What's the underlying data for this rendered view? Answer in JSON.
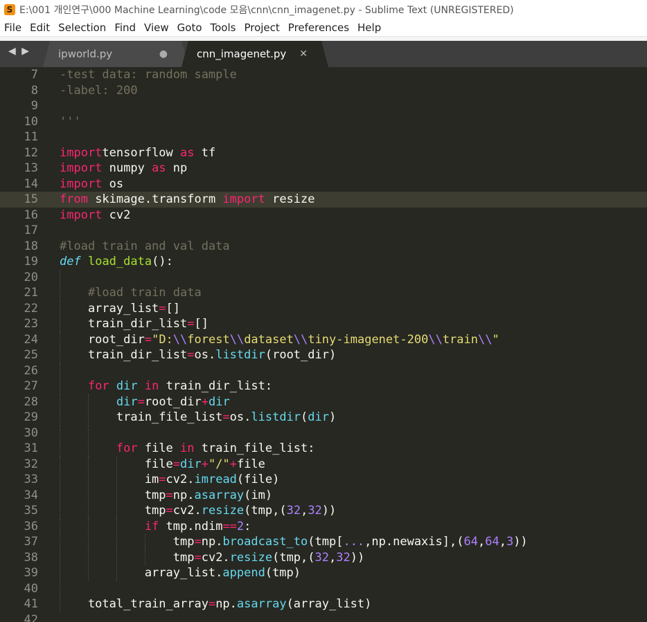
{
  "window": {
    "title": "E:\\001 개인연구\\000 Machine Learning\\code 모음\\cnn\\cnn_imagenet.py - Sublime Text (UNREGISTERED)",
    "app_icon_letter": "S"
  },
  "menu": [
    "File",
    "Edit",
    "Selection",
    "Find",
    "View",
    "Goto",
    "Tools",
    "Project",
    "Preferences",
    "Help"
  ],
  "tabs": [
    {
      "name": "ipworld.py",
      "marker": "●",
      "active": false
    },
    {
      "name": "cnn_imagenet.py",
      "marker": "✕",
      "active": true
    }
  ],
  "nav_arrows": "◀ ▶",
  "editor": {
    "current_line": 15,
    "colors": {
      "background": "#272822",
      "keyword": "#f92672",
      "string": "#e6db74",
      "comment": "#75715e",
      "number": "#ae81ff",
      "function": "#a6e22e",
      "builtin": "#66d9ef"
    },
    "lines": [
      {
        "n": 7,
        "segs": [
          [
            "cm",
            "-test data: random sample"
          ]
        ]
      },
      {
        "n": 8,
        "segs": [
          [
            "cm",
            "-label: 200"
          ]
        ]
      },
      {
        "n": 9,
        "segs": []
      },
      {
        "n": 10,
        "segs": [
          [
            "cm",
            "'''"
          ]
        ]
      },
      {
        "n": 11,
        "segs": []
      },
      {
        "n": 12,
        "segs": [
          [
            "kw",
            "import"
          ],
          [
            "",
            "tensorflow "
          ],
          [
            "kw",
            "as"
          ],
          [
            "",
            " tf"
          ]
        ]
      },
      {
        "n": 13,
        "segs": [
          [
            "kw",
            "import"
          ],
          [
            "",
            " numpy "
          ],
          [
            "kw",
            "as"
          ],
          [
            "",
            " np"
          ]
        ]
      },
      {
        "n": 14,
        "segs": [
          [
            "kw",
            "import"
          ],
          [
            "",
            " os"
          ]
        ]
      },
      {
        "n": 15,
        "segs": [
          [
            "kw",
            "from"
          ],
          [
            "",
            " skimage.transform "
          ],
          [
            "kw",
            "import"
          ],
          [
            "",
            " resize"
          ]
        ]
      },
      {
        "n": 16,
        "segs": [
          [
            "kw",
            "import"
          ],
          [
            "",
            " cv2"
          ]
        ]
      },
      {
        "n": 17,
        "segs": []
      },
      {
        "n": 18,
        "segs": [
          [
            "cm",
            "#load train and val data"
          ]
        ]
      },
      {
        "n": 19,
        "segs": [
          [
            "it",
            "def"
          ],
          [
            "",
            " "
          ],
          [
            "fn",
            "load_data"
          ],
          [
            "",
            "():"
          ]
        ]
      },
      {
        "n": 20,
        "segs": []
      },
      {
        "n": 21,
        "segs": [
          [
            "",
            "    "
          ],
          [
            "cm",
            "#load train data"
          ]
        ]
      },
      {
        "n": 22,
        "segs": [
          [
            "",
            "    array_list"
          ],
          [
            "kw",
            "="
          ],
          [
            "",
            "[]"
          ]
        ]
      },
      {
        "n": 23,
        "segs": [
          [
            "",
            "    train_dir_list"
          ],
          [
            "kw",
            "="
          ],
          [
            "",
            "[]"
          ]
        ]
      },
      {
        "n": 24,
        "segs": [
          [
            "",
            "    root_dir"
          ],
          [
            "kw",
            "="
          ],
          [
            "st",
            "\"D:"
          ],
          [
            "nm",
            "\\\\"
          ],
          [
            "st",
            "forest"
          ],
          [
            "nm",
            "\\\\"
          ],
          [
            "st",
            "dataset"
          ],
          [
            "nm",
            "\\\\"
          ],
          [
            "st",
            "tiny-imagenet-200"
          ],
          [
            "nm",
            "\\\\"
          ],
          [
            "st",
            "train"
          ],
          [
            "nm",
            "\\\\"
          ],
          [
            "st",
            "\""
          ]
        ]
      },
      {
        "n": 25,
        "segs": [
          [
            "",
            "    train_dir_list"
          ],
          [
            "kw",
            "="
          ],
          [
            "",
            "os."
          ],
          [
            "bi",
            "listdir"
          ],
          [
            "",
            "(root_dir)"
          ]
        ]
      },
      {
        "n": 26,
        "segs": []
      },
      {
        "n": 27,
        "segs": [
          [
            "",
            "    "
          ],
          [
            "kw",
            "for"
          ],
          [
            "",
            " "
          ],
          [
            "bi",
            "dir"
          ],
          [
            "",
            " "
          ],
          [
            "kw",
            "in"
          ],
          [
            "",
            " train_dir_list:"
          ]
        ]
      },
      {
        "n": 28,
        "segs": [
          [
            "",
            "        "
          ],
          [
            "bi",
            "dir"
          ],
          [
            "kw",
            "="
          ],
          [
            "",
            "root_dir"
          ],
          [
            "kw",
            "+"
          ],
          [
            "bi",
            "dir"
          ]
        ]
      },
      {
        "n": 29,
        "segs": [
          [
            "",
            "        train_file_list"
          ],
          [
            "kw",
            "="
          ],
          [
            "",
            "os."
          ],
          [
            "bi",
            "listdir"
          ],
          [
            "",
            "("
          ],
          [
            "bi",
            "dir"
          ],
          [
            "",
            ")"
          ]
        ]
      },
      {
        "n": 30,
        "segs": []
      },
      {
        "n": 31,
        "segs": [
          [
            "",
            "        "
          ],
          [
            "kw",
            "for"
          ],
          [
            "",
            " file "
          ],
          [
            "kw",
            "in"
          ],
          [
            "",
            " train_file_list:"
          ]
        ]
      },
      {
        "n": 32,
        "segs": [
          [
            "",
            "            file"
          ],
          [
            "kw",
            "="
          ],
          [
            "bi",
            "dir"
          ],
          [
            "kw",
            "+"
          ],
          [
            "st",
            "\"/\""
          ],
          [
            "kw",
            "+"
          ],
          [
            "",
            "file"
          ]
        ]
      },
      {
        "n": 33,
        "segs": [
          [
            "",
            "            im"
          ],
          [
            "kw",
            "="
          ],
          [
            "",
            "cv2."
          ],
          [
            "bi",
            "imread"
          ],
          [
            "",
            "(file)"
          ]
        ]
      },
      {
        "n": 34,
        "segs": [
          [
            "",
            "            tmp"
          ],
          [
            "kw",
            "="
          ],
          [
            "",
            "np."
          ],
          [
            "bi",
            "asarray"
          ],
          [
            "",
            "(im)"
          ]
        ]
      },
      {
        "n": 35,
        "segs": [
          [
            "",
            "            tmp"
          ],
          [
            "kw",
            "="
          ],
          [
            "",
            "cv2."
          ],
          [
            "bi",
            "resize"
          ],
          [
            "",
            "(tmp,("
          ],
          [
            "nm",
            "32"
          ],
          [
            "",
            ","
          ],
          [
            "nm",
            "32"
          ],
          [
            "",
            "))"
          ]
        ]
      },
      {
        "n": 36,
        "segs": [
          [
            "",
            "            "
          ],
          [
            "kw",
            "if"
          ],
          [
            "",
            " tmp.ndim"
          ],
          [
            "kw",
            "=="
          ],
          [
            "nm",
            "2"
          ],
          [
            "",
            ":"
          ]
        ]
      },
      {
        "n": 37,
        "segs": [
          [
            "",
            "                tmp"
          ],
          [
            "kw",
            "="
          ],
          [
            "",
            "np."
          ],
          [
            "bi",
            "broadcast_to"
          ],
          [
            "",
            "(tmp["
          ],
          [
            "nm",
            "..."
          ],
          [
            "",
            ",np.newaxis],("
          ],
          [
            "nm",
            "64"
          ],
          [
            "",
            ","
          ],
          [
            "nm",
            "64"
          ],
          [
            "",
            ","
          ],
          [
            "nm",
            "3"
          ],
          [
            "",
            "))"
          ]
        ]
      },
      {
        "n": 38,
        "segs": [
          [
            "",
            "                tmp"
          ],
          [
            "kw",
            "="
          ],
          [
            "",
            "cv2."
          ],
          [
            "bi",
            "resize"
          ],
          [
            "",
            "(tmp,("
          ],
          [
            "nm",
            "32"
          ],
          [
            "",
            ","
          ],
          [
            "nm",
            "32"
          ],
          [
            "",
            "))"
          ]
        ]
      },
      {
        "n": 39,
        "segs": [
          [
            "",
            "            array_list."
          ],
          [
            "bi",
            "append"
          ],
          [
            "",
            "(tmp)"
          ]
        ]
      },
      {
        "n": 40,
        "segs": []
      },
      {
        "n": 41,
        "segs": [
          [
            "",
            "    total_train_array"
          ],
          [
            "kw",
            "="
          ],
          [
            "",
            "np."
          ],
          [
            "bi",
            "asarray"
          ],
          [
            "",
            "(array_list)"
          ]
        ]
      },
      {
        "n": 42,
        "segs": []
      }
    ]
  }
}
